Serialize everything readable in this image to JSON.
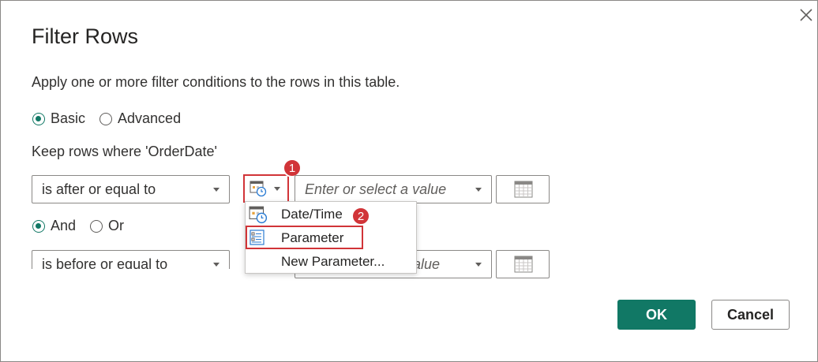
{
  "dialog": {
    "title": "Filter Rows",
    "description": "Apply one or more filter conditions to the rows in this table.",
    "mode_options": [
      {
        "label": "Basic",
        "checked": true
      },
      {
        "label": "Advanced",
        "checked": false
      }
    ],
    "keep_rows_label": "Keep rows where 'OrderDate'"
  },
  "condition1": {
    "operator": "is after or equal to",
    "value_placeholder": "Enter or select a value",
    "type_icon": "date-time-icon"
  },
  "logic_options": [
    {
      "label": "And",
      "checked": true
    },
    {
      "label": "Or",
      "checked": false
    }
  ],
  "condition2": {
    "operator": "is before or equal to",
    "value_partial": "alue"
  },
  "type_menu": {
    "items": [
      {
        "label": "Date/Time",
        "icon": "date-time-icon"
      },
      {
        "label": "Parameter",
        "icon": "parameter-icon"
      },
      {
        "label": "New Parameter...",
        "icon": ""
      }
    ]
  },
  "callouts": [
    "1",
    "2"
  ],
  "buttons": {
    "ok": "OK",
    "cancel": "Cancel"
  },
  "colors": {
    "accent": "#117865",
    "callout": "#d13438",
    "border": "#8a8886"
  }
}
